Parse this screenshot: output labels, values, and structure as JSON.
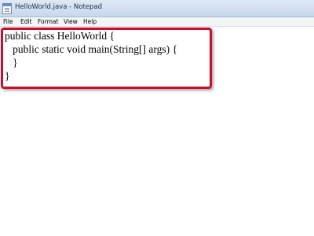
{
  "window": {
    "title": "HelloWorld.java - Notepad"
  },
  "menu": [
    {
      "label": "File"
    },
    {
      "label": "Edit"
    },
    {
      "label": "Format"
    },
    {
      "label": "View"
    },
    {
      "label": "Help"
    }
  ],
  "editor": {
    "lines": [
      "public class HelloWorld {",
      "   public static void main(String[] args) {",
      "   }",
      "}"
    ]
  },
  "highlight": {
    "color": "#c8102e"
  }
}
